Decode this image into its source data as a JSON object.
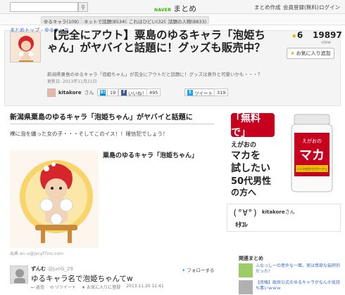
{
  "topbar": {
    "logo_brand": "NAVER",
    "logo_text": "まとめ",
    "nav": [
      "まとめ作成",
      "会員登録(無料)",
      "ログイン"
    ]
  },
  "categories": [
    {
      "name": "ゆるキャラ",
      "count": "(109)"
    },
    {
      "name": "ネットで話題",
      "count": "(85349)"
    },
    {
      "name": "これはひどい",
      "count": "(32989)"
    },
    {
      "name": "話題の人物",
      "count": "(8833)"
    }
  ],
  "breadcrumb": {
    "home": "まとめトップ",
    "current": "ゆるキャラ"
  },
  "article": {
    "title": "【完全にアウト】粟島のゆるキャラ「泡姫ちゃん」がヤバイと話題に！グッズも販売中？",
    "description": "新潟県粟島のゆるキャラ「泡姫ちゃん」が完全にアウトだと話題に！グッズは意外と可愛いかも・・・？",
    "date": "更新日: 2013年11月21日",
    "author": "kitakore",
    "author_suffix": "さん",
    "likes": "6",
    "views": "19897",
    "views_label": "view",
    "fav_button": "お気に入り追加",
    "share": {
      "hatena_label": "B!",
      "hatena_count": "19",
      "fb_label": "いいね！",
      "fb_count": "495",
      "tweet_label": "ツイート",
      "tweet_count": "319"
    }
  },
  "content": {
    "section_title": "新潟県粟島のゆるキャラ「泡姫ちゃん」がヤバイと話題に",
    "text": "裸に泡を纏った女の子・・・そしてこのイス！！確信犯でしょう！",
    "item_title": "粟島のゆるキャラ「泡姫ちゃん」",
    "source": "出典 sn-.o@jxcyf7inc.com",
    "tweet": {
      "name": "ずんむ",
      "handle": "@JunG_29",
      "follow": "フォローする",
      "text": "ゆるキャラ名で泡姫ちゃんてw",
      "actions": [
        "返信",
        "リツイート",
        "お気に入りに登録",
        "2013.11.20 12:41"
      ]
    }
  },
  "sidebar": {
    "ad": {
      "bubble": "「無料で」",
      "line1": "えがおの",
      "line2": "マカを",
      "line3": "試したい",
      "line4": "50代男性",
      "line5": "の方へ",
      "bottle_title": "マカ",
      "bottle_brand": "えがおの",
      "bottle_sub": "ニンニクの力でパワーアップ"
    },
    "profile": {
      "face": "(°∀°)",
      "name": "kitakore",
      "suffix": "さん",
      "kana": "ｷﾀｺﾚ"
    },
    "related": {
      "heading": "関連まとめ",
      "items": [
        "ふなっしーの意外な一面。実は意欲な裂肝的だった！",
        "【悲報】政府公式のゆるキャラがなんか気持ち悪いｗｗｗ"
      ]
    }
  },
  "colors": {
    "naver_green": "#2db400",
    "link_blue": "#3366cc",
    "ad_red": "#c7001d",
    "star": "#f0a800"
  }
}
